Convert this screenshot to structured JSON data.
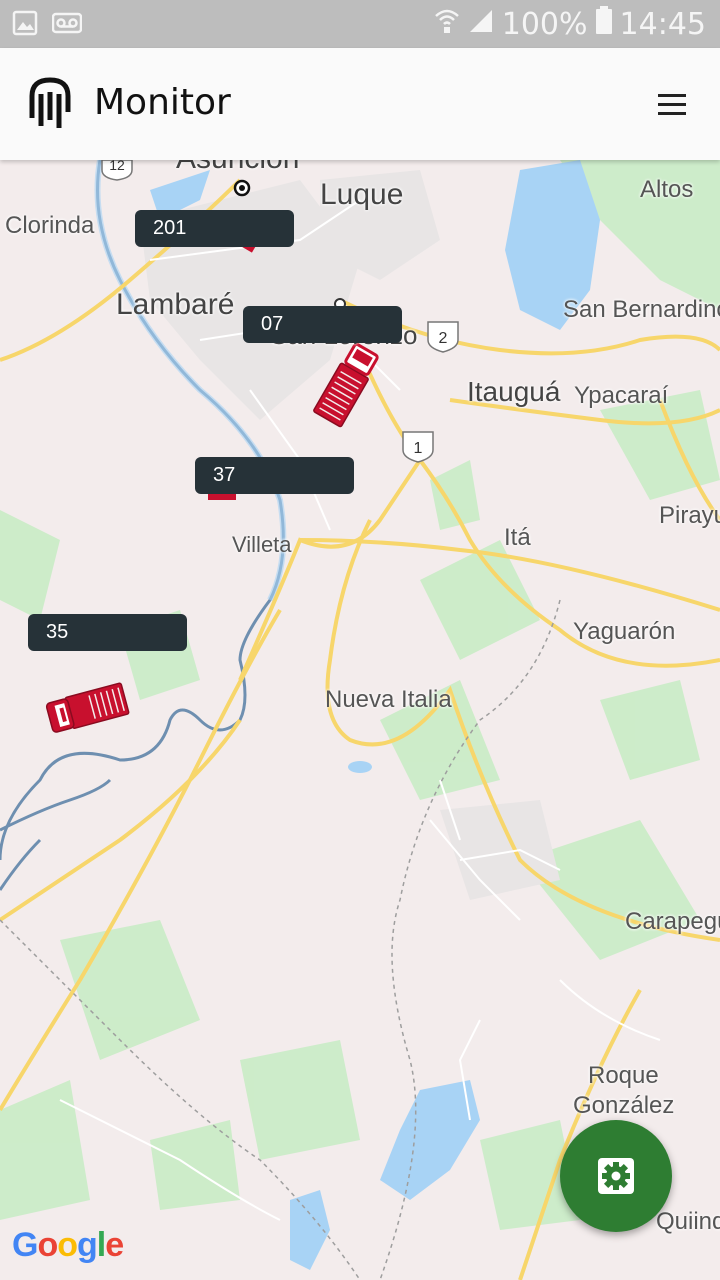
{
  "status_bar": {
    "battery_percent": "100%",
    "time": "14:45",
    "icons": [
      "image-icon",
      "voicemail-icon",
      "wifi-icon",
      "signal-icon",
      "battery-icon"
    ]
  },
  "app": {
    "title": "Monitor",
    "menu_icon": "hamburger-menu-icon"
  },
  "map": {
    "places": [
      {
        "name": "Asunción"
      },
      {
        "name": "Luque"
      },
      {
        "name": "Clorinda"
      },
      {
        "name": "Lambaré"
      },
      {
        "name": "Altos"
      },
      {
        "name": "San Bernardino"
      },
      {
        "name": "Itauguá"
      },
      {
        "name": "Ypacaraí"
      },
      {
        "name": "San Lorenzo"
      },
      {
        "name": "Villeta"
      },
      {
        "name": "Itá"
      },
      {
        "name": "Pirayu"
      },
      {
        "name": "Yaguarón"
      },
      {
        "name": "Nueva Italia"
      },
      {
        "name": "Carapegu"
      },
      {
        "name": "Roque"
      },
      {
        "name": "González"
      },
      {
        "name": "Quiind"
      }
    ],
    "route_shields": [
      "12",
      "2",
      "1"
    ],
    "vehicles": [
      {
        "label": "201"
      },
      {
        "label": "07"
      },
      {
        "label": "37"
      },
      {
        "label": "35"
      }
    ],
    "attribution": "Google"
  },
  "fab": {
    "icon": "settings-gear-icon"
  },
  "colors": {
    "status_bar": "#bdbdbd",
    "app_bar": "#fafafa",
    "vehicle_label_bg": "#263238",
    "truck_red": "#c8102e",
    "fab_green": "#2e7d32",
    "water": "#a8d3f5",
    "road_yellow": "#f7d66b",
    "map_bg": "#f3ecec"
  }
}
